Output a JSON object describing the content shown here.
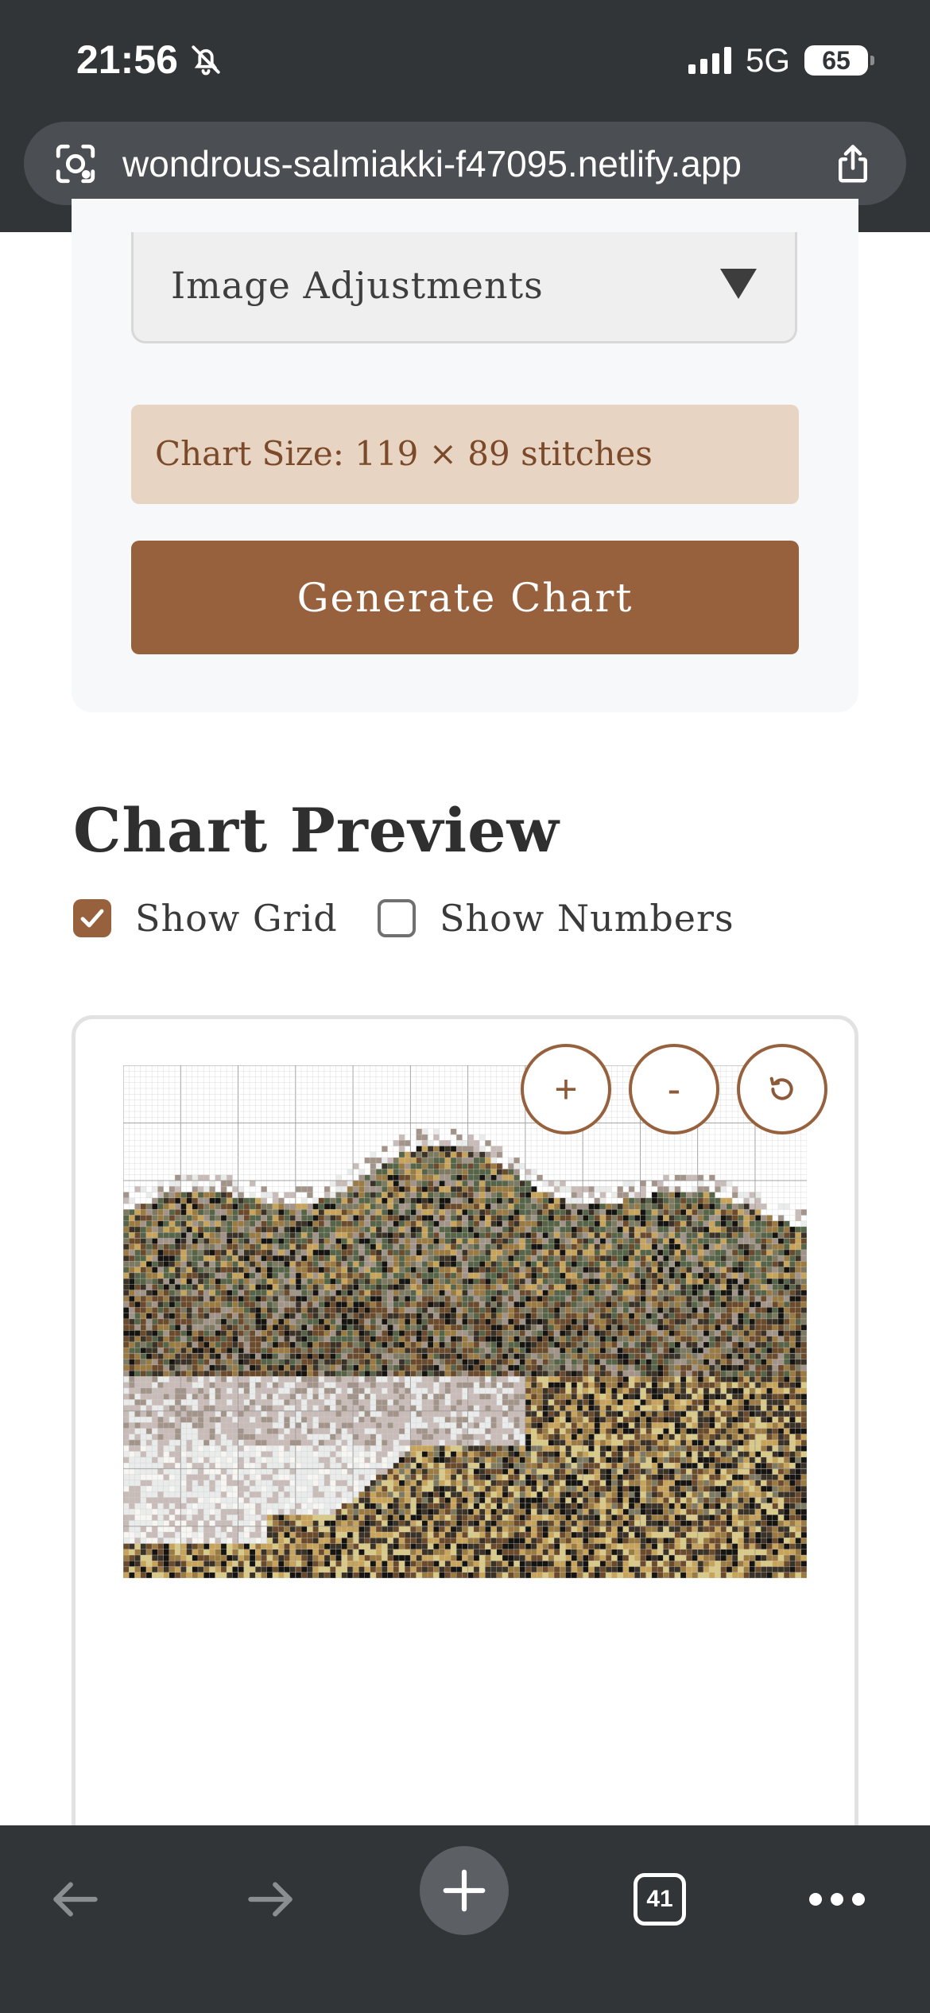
{
  "status_bar": {
    "time": "21:56",
    "network": "5G",
    "battery": "65"
  },
  "browser": {
    "url": "wondrous-salmiakki-f47095.netlify.app",
    "tab_count": "41"
  },
  "adjustments": {
    "label": "Image Adjustments"
  },
  "chart_info": {
    "size_text": "Chart Size: 119 × 89 stitches"
  },
  "generate": {
    "label": "Generate Chart"
  },
  "preview": {
    "title": "Chart Preview",
    "show_grid": {
      "label": "Show Grid",
      "checked": true
    },
    "show_numbers": {
      "label": "Show Numbers",
      "checked": false
    }
  },
  "zoom_controls": {
    "zoom_in": "+",
    "zoom_out": "-",
    "reset": "⟲"
  },
  "palette": [
    "#e9eceb",
    "#c9bcb8",
    "#a39489",
    "#7d7a61",
    "#566547",
    "#3a3226",
    "#151410",
    "#6b4b2c",
    "#9b7b42",
    "#c8a45a",
    "#d9c987",
    "#f7f6f2"
  ],
  "colors": {
    "accent": "#98613e",
    "chart_size_bg": "#e8d4c2",
    "browser_chrome": "#323538"
  }
}
